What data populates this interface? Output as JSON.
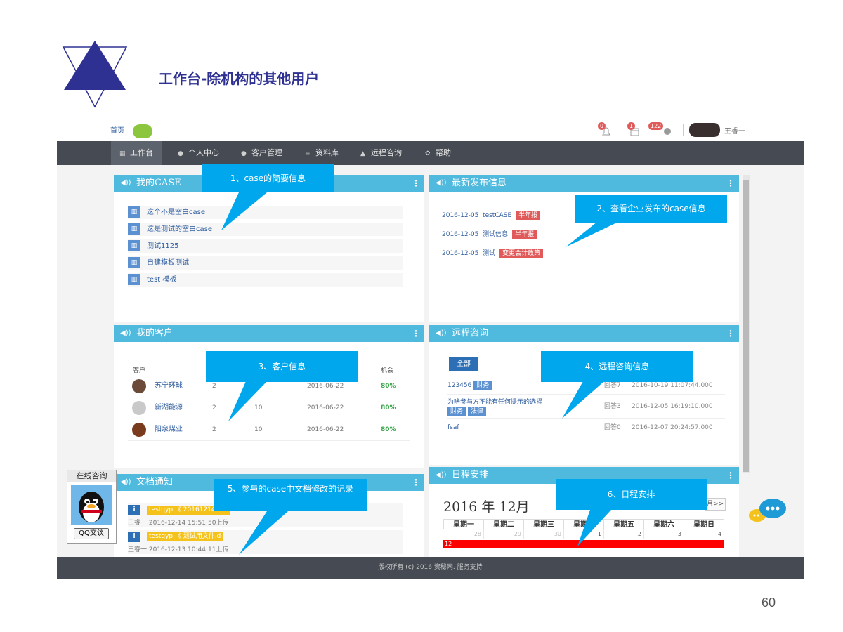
{
  "slide": {
    "title": "工作台-除机构的其他用户",
    "page_number": "60"
  },
  "topbar": {
    "home": "首页",
    "badges": [
      "0",
      "1",
      "122"
    ],
    "user_name": "王睿一"
  },
  "nav": [
    {
      "icon": "grid-icon",
      "label": "工作台"
    },
    {
      "icon": "user-icon",
      "label": "个人中心"
    },
    {
      "icon": "chat-icon",
      "label": "客户管理"
    },
    {
      "icon": "database-icon",
      "label": "资料库"
    },
    {
      "icon": "person-icon",
      "label": "远程咨询"
    },
    {
      "icon": "gear-icon",
      "label": "帮助"
    }
  ],
  "panels": {
    "my_case": {
      "title": "我的CASE",
      "items": [
        "这个不是空白case",
        "这是测试的空白case",
        "测试1125",
        "自建模板测试",
        "test 模板"
      ]
    },
    "latest": {
      "title": "最新发布信息",
      "items": [
        {
          "date": "2016-12-05",
          "text": "testCASE",
          "tag": "半年报"
        },
        {
          "date": "2016-12-05",
          "text": "测试信息",
          "tag": "半年报"
        },
        {
          "date": "2016-12-05",
          "text": "测试",
          "tag": "变更会计政策"
        }
      ]
    },
    "customers": {
      "title": "我的客户",
      "headers": {
        "customer": "客户",
        "chance": "机会"
      },
      "rows": [
        {
          "name": "苏宁环球",
          "c1": "2",
          "c2": "",
          "date": "2016-06-22",
          "pct": "80%"
        },
        {
          "name": "新湖能源",
          "c1": "2",
          "c2": "10",
          "date": "2016-06-22",
          "pct": "80%"
        },
        {
          "name": "阳泉煤业",
          "c1": "2",
          "c2": "10",
          "date": "2016-06-22",
          "pct": "80%"
        }
      ]
    },
    "consult": {
      "title": "远程咨询",
      "all_button": "全部",
      "rows": [
        {
          "title": "123456",
          "tags": [
            "财务"
          ],
          "answers": "回答7",
          "time": "2016-10-19 11:07:44.000"
        },
        {
          "title": "为啥参与方不能有任何提示的选择",
          "tags": [
            "财务",
            "法律"
          ],
          "answers": "回答3",
          "time": "2016-12-05 16:19:10.000"
        },
        {
          "title": "fsaf",
          "tags": [],
          "answers": "回答0",
          "time": "2016-12-07 20:24:57.000"
        }
      ]
    },
    "docs": {
      "title": "文档通知",
      "rows": [
        {
          "user_tag": "testqyp",
          "file": "20161214090",
          "meta": "王睿一  2016-12-14 15:51:50上传"
        },
        {
          "user_tag": "testqyp",
          "file": "测试用文件.d",
          "meta": "王睿一  2016-12-13 10:44:11上传"
        }
      ]
    },
    "schedule": {
      "title": "日程安排",
      "year": "2016",
      "year_unit": "年",
      "month": "12月",
      "next_button": "月>>",
      "weekdays": [
        "星期一",
        "星期二",
        "星期三",
        "星期四",
        "星期五",
        "星期六",
        "星期日"
      ],
      "week1": [
        "28",
        "29",
        "30",
        "1",
        "2",
        "3",
        "4"
      ],
      "event_label": "12"
    }
  },
  "callouts": {
    "c1": "1、case的简要信息",
    "c2": "2、查看企业发布的case信息",
    "c3": "3、客户信息",
    "c4": "4、远程咨询信息",
    "c5": "5、参与的case中文档修改的记录",
    "c6": "6、日程安排"
  },
  "online": {
    "title": "在线咨询",
    "button": "QQ交谈"
  },
  "footer": {
    "text": "版权所有 (c) 2016 资秘网. 服务支持"
  },
  "colors": {
    "title": "#2e3192",
    "nav_bg": "#454a53",
    "panel_head": "#4fb9de",
    "callout": "#00a7ec",
    "tag_red": "#e05a5a",
    "tag_blue": "#5b90d1",
    "event_red": "#ff0000"
  }
}
